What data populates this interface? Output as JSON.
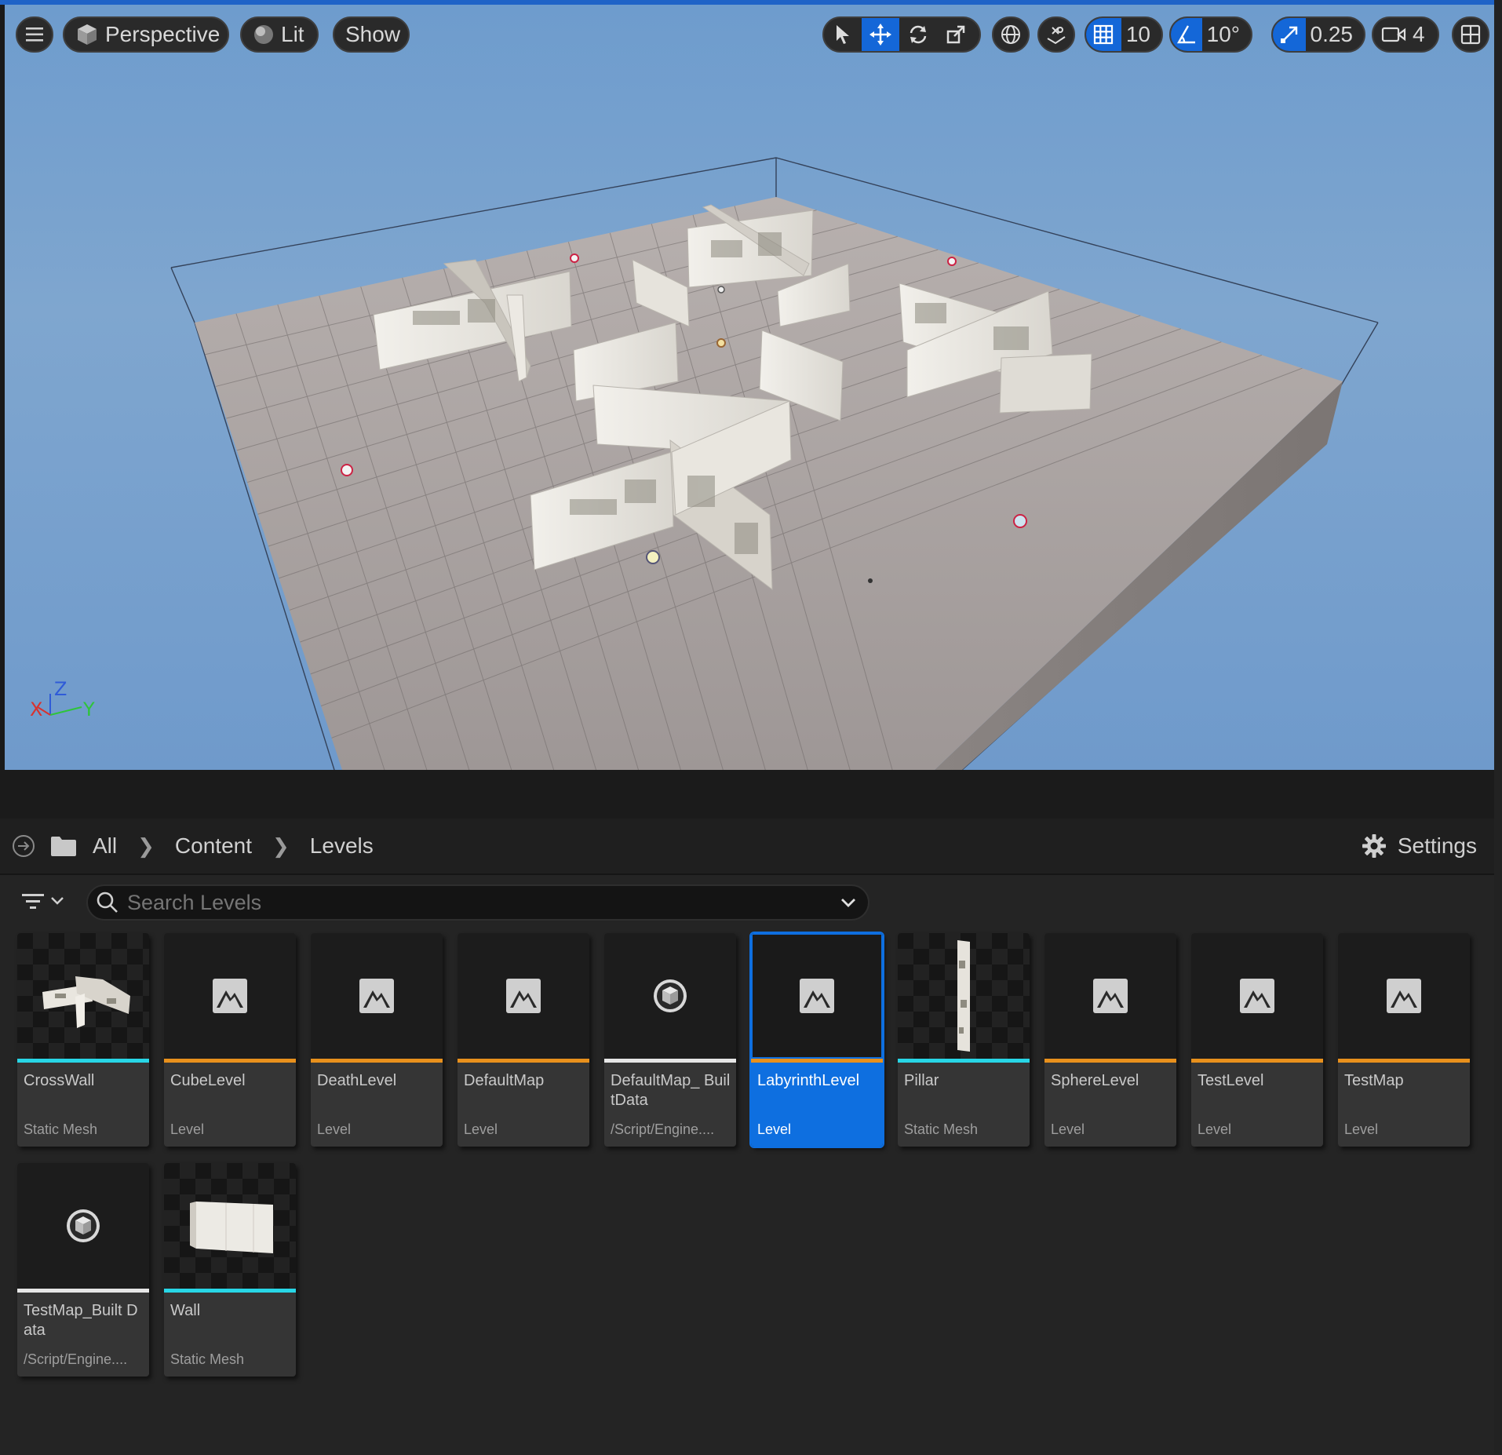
{
  "viewport": {
    "toolbar": {
      "menu_icon": "hamburger-icon",
      "perspective_label": "Perspective",
      "lit_label": "Lit",
      "show_label": "Show",
      "grid_snap_value": "10",
      "rotation_snap_value": "10°",
      "scale_snap_value": "0.25",
      "camera_speed_value": "4"
    },
    "axis": {
      "x": "X",
      "y": "Y",
      "z": "Z"
    }
  },
  "browser": {
    "breadcrumb": [
      "All",
      "Content",
      "Levels"
    ],
    "settings_label": "Settings",
    "search": {
      "placeholder": "Search Levels",
      "value": ""
    },
    "assets": [
      {
        "name": "CrossWall",
        "type": "Static Mesh",
        "kind": "mesh-cross",
        "stripe": "#28d6e6"
      },
      {
        "name": "CubeLevel",
        "type": "Level",
        "kind": "level",
        "stripe": "#e8901c"
      },
      {
        "name": "DeathLevel",
        "type": "Level",
        "kind": "level",
        "stripe": "#e8901c"
      },
      {
        "name": "DefaultMap",
        "type": "Level",
        "kind": "level",
        "stripe": "#e8901c"
      },
      {
        "name": "DefaultMap_ BuiltData",
        "type": "/Script/Engine....",
        "kind": "builtdata",
        "stripe": "#e6e6e6"
      },
      {
        "name": "LabyrinthLevel",
        "type": "Level",
        "kind": "level",
        "stripe": "#e8901c",
        "selected": true
      },
      {
        "name": "Pillar",
        "type": "Static Mesh",
        "kind": "mesh-pillar",
        "stripe": "#28d6e6"
      },
      {
        "name": "SphereLevel",
        "type": "Level",
        "kind": "level",
        "stripe": "#e8901c"
      },
      {
        "name": "TestLevel",
        "type": "Level",
        "kind": "level",
        "stripe": "#e8901c"
      },
      {
        "name": "TestMap",
        "type": "Level",
        "kind": "level",
        "stripe": "#e8901c"
      },
      {
        "name": "TestMap_Built Data",
        "type": "/Script/Engine....",
        "kind": "builtdata",
        "stripe": "#e6e6e6"
      },
      {
        "name": "Wall",
        "type": "Static Mesh",
        "kind": "mesh-wall",
        "stripe": "#28d6e6"
      }
    ]
  }
}
